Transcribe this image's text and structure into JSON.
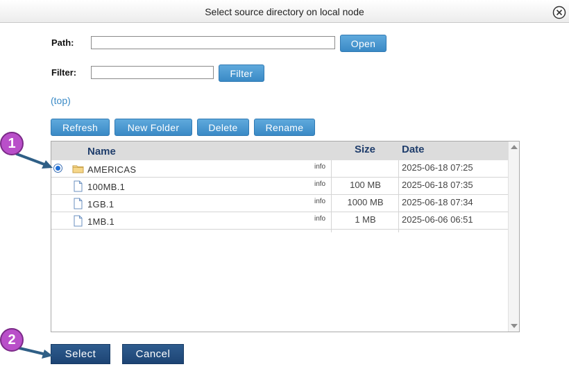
{
  "dialog": {
    "title": "Select source directory on local node"
  },
  "path": {
    "label": "Path:",
    "value": "",
    "open_label": "Open"
  },
  "filter": {
    "label": "Filter:",
    "value": "",
    "button_label": "Filter"
  },
  "top_link": "(top)",
  "toolbar": {
    "refresh": "Refresh",
    "new_folder": "New Folder",
    "delete": "Delete",
    "rename": "Rename"
  },
  "table": {
    "headers": {
      "name": "Name",
      "size": "Size",
      "date": "Date"
    },
    "rows": [
      {
        "type": "folder",
        "name": "AMERICAS",
        "info": "info",
        "size": "",
        "date": "2025-06-18 07:25",
        "selected": true
      },
      {
        "type": "file",
        "name": "100MB.1",
        "info": "info",
        "size": "100 MB",
        "date": "2025-06-18 07:35",
        "selected": false
      },
      {
        "type": "file",
        "name": "1GB.1",
        "info": "info",
        "size": "1000 MB",
        "date": "2025-06-18 07:34",
        "selected": false
      },
      {
        "type": "file",
        "name": "1MB.1",
        "info": "info",
        "size": "1 MB",
        "date": "2025-06-06 06:51",
        "selected": false
      }
    ]
  },
  "footer": {
    "select": "Select",
    "cancel": "Cancel"
  },
  "annotations": {
    "badge1": "1",
    "badge2": "2",
    "badge_color": "#b94fc9",
    "arrow_color": "#2f5f86"
  },
  "icons": {
    "close": "close-circle-icon",
    "folder": "folder-icon",
    "file": "file-icon"
  }
}
